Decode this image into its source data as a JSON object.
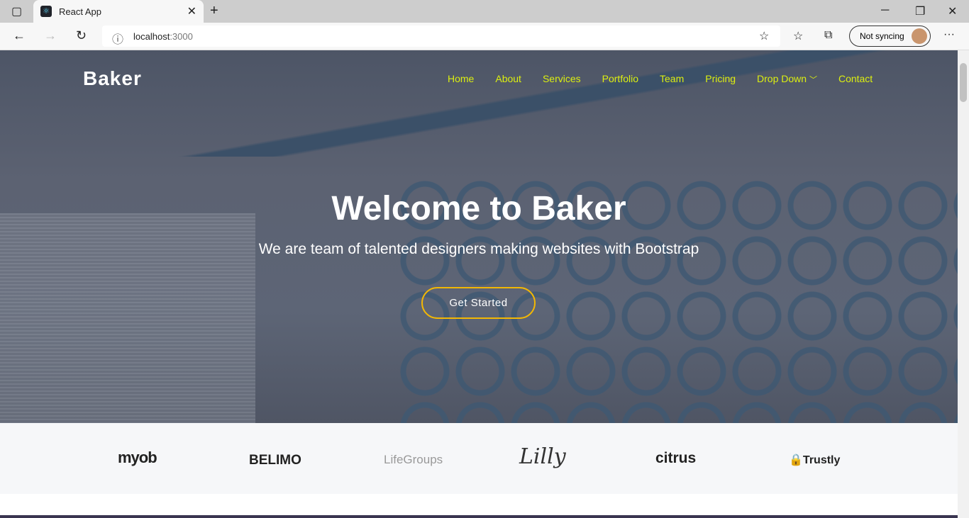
{
  "browser": {
    "tab_title": "React App",
    "url_host": "localhost",
    "url_port": ":3000",
    "sync_label": "Not syncing"
  },
  "site": {
    "brand": "Baker",
    "nav": [
      "Home",
      "About",
      "Services",
      "Portfolio",
      "Team",
      "Pricing",
      "Drop Down",
      "Contact"
    ],
    "hero_title": "Welcome to Baker",
    "hero_subtitle": "We are team of talented designers making websites with Bootstrap",
    "cta": "Get Started",
    "nav_color": "#dcef10",
    "cta_border": "#f2b705",
    "clients": [
      "myob",
      "BELIMO",
      "LifeGroups",
      "Lilly",
      "citrus",
      "Trustly"
    ]
  }
}
